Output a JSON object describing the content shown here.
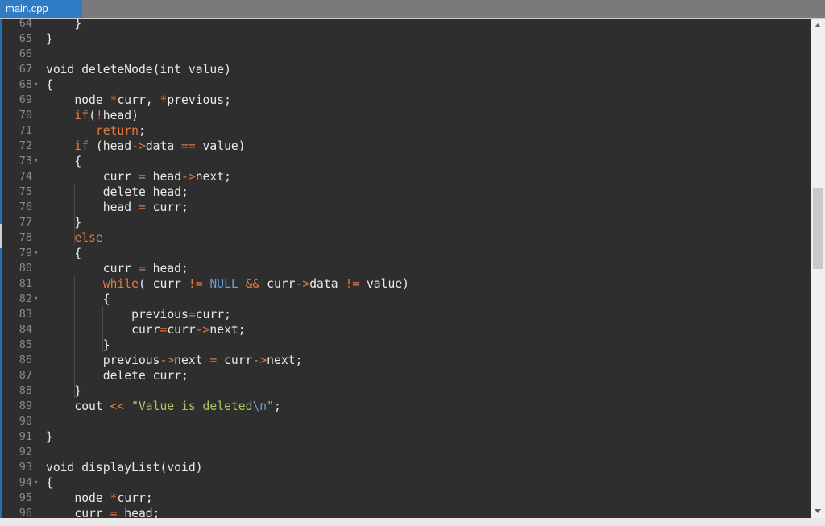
{
  "tab": {
    "filename": "main.cpp"
  },
  "colors": {
    "tab_bg": "#2f7bc6",
    "editor_bg": "#2e2e2e",
    "keyword": "#e2793f",
    "string": "#a8c95e",
    "constant": "#6e9ed2",
    "text": "#ebebeb",
    "line_number": "#8a8a8a"
  },
  "editor": {
    "lines": [
      {
        "n": "64",
        "fold": false,
        "tokens": [
          [
            "    }",
            ""
          ]
        ]
      },
      {
        "n": "65",
        "fold": false,
        "tokens": [
          [
            "}",
            ""
          ]
        ]
      },
      {
        "n": "66",
        "fold": false,
        "tokens": []
      },
      {
        "n": "67",
        "fold": false,
        "tokens": [
          [
            "void deleteNode(int value)",
            ""
          ]
        ]
      },
      {
        "n": "68",
        "fold": true,
        "tokens": [
          [
            "{",
            ""
          ]
        ]
      },
      {
        "n": "69",
        "fold": false,
        "tokens": [
          [
            "    node ",
            ""
          ],
          [
            "*",
            "op"
          ],
          [
            "curr, ",
            ""
          ],
          [
            "*",
            "op"
          ],
          [
            "previous;",
            ""
          ]
        ]
      },
      {
        "n": "70",
        "fold": false,
        "tokens": [
          [
            "    ",
            ""
          ],
          [
            "if",
            "kw"
          ],
          [
            "(",
            ""
          ],
          [
            "!",
            "op"
          ],
          [
            "head)",
            ""
          ]
        ]
      },
      {
        "n": "71",
        "fold": false,
        "tokens": [
          [
            "       ",
            ""
          ],
          [
            "return",
            "kw"
          ],
          [
            ";",
            ""
          ]
        ]
      },
      {
        "n": "72",
        "fold": false,
        "tokens": [
          [
            "    ",
            ""
          ],
          [
            "if",
            "kw"
          ],
          [
            " (head",
            ""
          ],
          [
            "->",
            "op"
          ],
          [
            "data ",
            ""
          ],
          [
            "==",
            "op"
          ],
          [
            " value)",
            ""
          ]
        ]
      },
      {
        "n": "73",
        "fold": true,
        "tokens": [
          [
            "    {",
            ""
          ]
        ]
      },
      {
        "n": "74",
        "fold": false,
        "tokens": [
          [
            "        curr ",
            ""
          ],
          [
            "=",
            "op"
          ],
          [
            " head",
            ""
          ],
          [
            "->",
            "op"
          ],
          [
            "next;",
            ""
          ]
        ]
      },
      {
        "n": "75",
        "fold": false,
        "tokens": [
          [
            "        delete head;",
            ""
          ]
        ]
      },
      {
        "n": "76",
        "fold": false,
        "tokens": [
          [
            "        head ",
            ""
          ],
          [
            "=",
            "op"
          ],
          [
            " curr;",
            ""
          ]
        ]
      },
      {
        "n": "77",
        "fold": false,
        "tokens": [
          [
            "    }",
            ""
          ]
        ]
      },
      {
        "n": "78",
        "fold": false,
        "tokens": [
          [
            "    ",
            ""
          ],
          [
            "else",
            "kw"
          ]
        ]
      },
      {
        "n": "79",
        "fold": true,
        "tokens": [
          [
            "    {",
            ""
          ]
        ]
      },
      {
        "n": "80",
        "fold": false,
        "tokens": [
          [
            "        curr ",
            ""
          ],
          [
            "=",
            "op"
          ],
          [
            " head;",
            ""
          ]
        ]
      },
      {
        "n": "81",
        "fold": false,
        "tokens": [
          [
            "        ",
            ""
          ],
          [
            "while",
            "kw"
          ],
          [
            "( curr ",
            ""
          ],
          [
            "!=",
            "op"
          ],
          [
            " ",
            ""
          ],
          [
            "NULL",
            "null"
          ],
          [
            " ",
            ""
          ],
          [
            "&&",
            "op"
          ],
          [
            " curr",
            ""
          ],
          [
            "->",
            "op"
          ],
          [
            "data ",
            ""
          ],
          [
            "!=",
            "op"
          ],
          [
            " value)",
            ""
          ]
        ]
      },
      {
        "n": "82",
        "fold": true,
        "tokens": [
          [
            "        {",
            ""
          ]
        ]
      },
      {
        "n": "83",
        "fold": false,
        "tokens": [
          [
            "            previous",
            ""
          ],
          [
            "=",
            "op"
          ],
          [
            "curr;",
            ""
          ]
        ]
      },
      {
        "n": "84",
        "fold": false,
        "tokens": [
          [
            "            curr",
            ""
          ],
          [
            "=",
            "op"
          ],
          [
            "curr",
            ""
          ],
          [
            "->",
            "op"
          ],
          [
            "next;",
            ""
          ]
        ]
      },
      {
        "n": "85",
        "fold": false,
        "tokens": [
          [
            "        }",
            ""
          ]
        ]
      },
      {
        "n": "86",
        "fold": false,
        "tokens": [
          [
            "        previous",
            ""
          ],
          [
            "->",
            "op"
          ],
          [
            "next ",
            ""
          ],
          [
            "=",
            "op"
          ],
          [
            " curr",
            ""
          ],
          [
            "->",
            "op"
          ],
          [
            "next;",
            ""
          ]
        ]
      },
      {
        "n": "87",
        "fold": false,
        "tokens": [
          [
            "        delete curr;",
            ""
          ]
        ]
      },
      {
        "n": "88",
        "fold": false,
        "tokens": [
          [
            "    }",
            ""
          ]
        ]
      },
      {
        "n": "89",
        "fold": false,
        "tokens": [
          [
            "    cout ",
            ""
          ],
          [
            "<<",
            "op"
          ],
          [
            " ",
            ""
          ],
          [
            "\"Value is deleted",
            "str"
          ],
          [
            "\\n",
            "esc"
          ],
          [
            "\"",
            "str"
          ],
          [
            ";",
            ""
          ]
        ]
      },
      {
        "n": "90",
        "fold": false,
        "tokens": []
      },
      {
        "n": "91",
        "fold": false,
        "tokens": [
          [
            "}",
            ""
          ]
        ]
      },
      {
        "n": "92",
        "fold": false,
        "tokens": []
      },
      {
        "n": "93",
        "fold": false,
        "tokens": [
          [
            "void displayList(void)",
            ""
          ]
        ]
      },
      {
        "n": "94",
        "fold": true,
        "tokens": [
          [
            "{",
            ""
          ]
        ]
      },
      {
        "n": "95",
        "fold": false,
        "tokens": [
          [
            "    node ",
            ""
          ],
          [
            "*",
            "op"
          ],
          [
            "curr;",
            ""
          ]
        ]
      },
      {
        "n": "96",
        "fold": false,
        "tokens": [
          [
            "    curr ",
            ""
          ],
          [
            "=",
            "op"
          ],
          [
            " head;",
            ""
          ]
        ]
      }
    ]
  }
}
